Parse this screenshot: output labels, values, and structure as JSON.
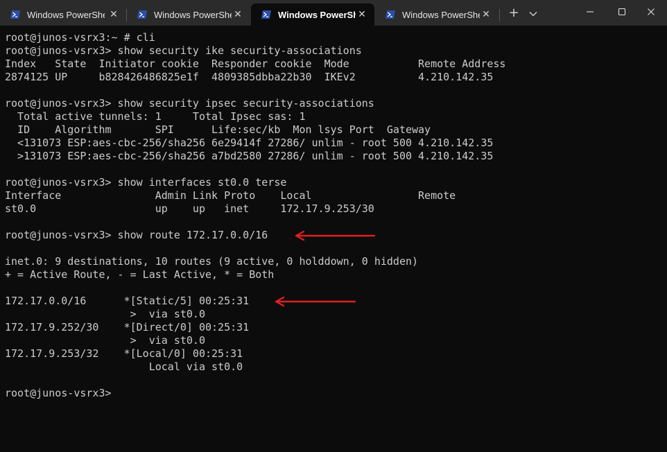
{
  "tabs": [
    {
      "title": "Windows PowerShell",
      "active": false
    },
    {
      "title": "Windows PowerShell",
      "active": false
    },
    {
      "title": "Windows PowerShell",
      "active": true
    },
    {
      "title": "Windows PowerShell",
      "active": false
    }
  ],
  "icons": {
    "tab": "powershell-icon",
    "tab_close": "close-icon",
    "new_tab": "plus-icon",
    "dropdown": "chevron-down-icon",
    "minimize": "minimize-icon",
    "maximize": "maximize-icon",
    "close_window": "close-icon",
    "annotation": "red-arrow-icon"
  },
  "colors": {
    "terminal_bg": "#0c0c0c",
    "text": "#cccccc",
    "titlebar": "#2b2b2b",
    "annotation": "#e02020",
    "powershell_icon": "#2a4fa8"
  },
  "terminal_lines": [
    "root@junos-vsrx3:~ # cli",
    "root@junos-vsrx3> show security ike security-associations",
    "Index   State  Initiator cookie  Responder cookie  Mode           Remote Address",
    "2874125 UP     b828426486825e1f  4809385dbba22b30  IKEv2          4.210.142.35",
    "",
    "root@junos-vsrx3> show security ipsec security-associations",
    "  Total active tunnels: 1     Total Ipsec sas: 1",
    "  ID    Algorithm       SPI      Life:sec/kb  Mon lsys Port  Gateway",
    "  <131073 ESP:aes-cbc-256/sha256 6e29414f 27286/ unlim - root 500 4.210.142.35",
    "  >131073 ESP:aes-cbc-256/sha256 a7bd2580 27286/ unlim - root 500 4.210.142.35",
    "",
    "root@junos-vsrx3> show interfaces st0.0 terse",
    "Interface               Admin Link Proto    Local                 Remote",
    "st0.0                   up    up   inet     172.17.9.253/30",
    "",
    "root@junos-vsrx3> show route 172.17.0.0/16",
    "",
    "inet.0: 9 destinations, 10 routes (9 active, 0 holddown, 0 hidden)",
    "+ = Active Route, - = Last Active, * = Both",
    "",
    "172.17.0.0/16      *[Static/5] 00:25:31",
    "                    >  via st0.0",
    "172.17.9.252/30    *[Direct/0] 00:25:31",
    "                    >  via st0.0",
    "172.17.9.253/32    *[Local/0] 00:25:31",
    "                       Local via st0.0",
    "",
    "root@junos-vsrx3>"
  ]
}
